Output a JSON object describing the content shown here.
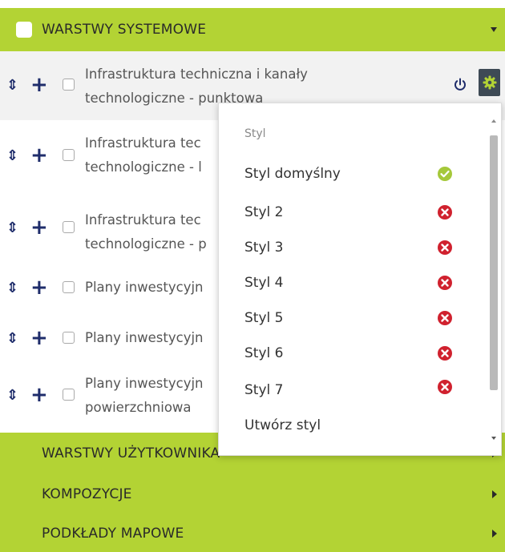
{
  "colors": {
    "header_green": "#b3d334",
    "navy": "#1f2d6b",
    "gear_bg": "#3e4a55",
    "ok_green": "#a5c83a",
    "error_red": "#d0212e"
  },
  "sections": {
    "system": {
      "label": "WARSTWY SYSTEMOWE",
      "expanded": true
    },
    "user": {
      "label": "WARSTWY UŻYTKOWNIKA"
    },
    "compositions": {
      "label": "KOMPOZYCJE"
    },
    "basemaps": {
      "label": "PODKŁADY MAPOWE"
    }
  },
  "layers": [
    {
      "line1": "Infrastruktura techniczna i kanały",
      "line2": "technologiczne - punktowa"
    },
    {
      "line1": "Infrastruktura tec",
      "line2": "technologiczne - l"
    },
    {
      "line1": "Infrastruktura tec",
      "line2": "technologiczne - p"
    },
    {
      "line1": "Plany inwestycyjn",
      "line2": ""
    },
    {
      "line1": "Plany inwestycyjn",
      "line2": ""
    },
    {
      "line1": "Plany inwestycyjn",
      "line2": "powierzchniowa"
    }
  ],
  "style_menu": {
    "title": "Styl",
    "items": [
      {
        "label": "Styl domyślny",
        "status": "active"
      },
      {
        "label": "Styl 2",
        "status": "remove"
      },
      {
        "label": "Styl 3",
        "status": "remove"
      },
      {
        "label": "Styl 4",
        "status": "remove"
      },
      {
        "label": "Styl 5",
        "status": "remove"
      },
      {
        "label": "Styl 6",
        "status": "remove"
      },
      {
        "label": "Styl 7",
        "status": "remove"
      }
    ],
    "create_label": "Utwórz styl"
  }
}
